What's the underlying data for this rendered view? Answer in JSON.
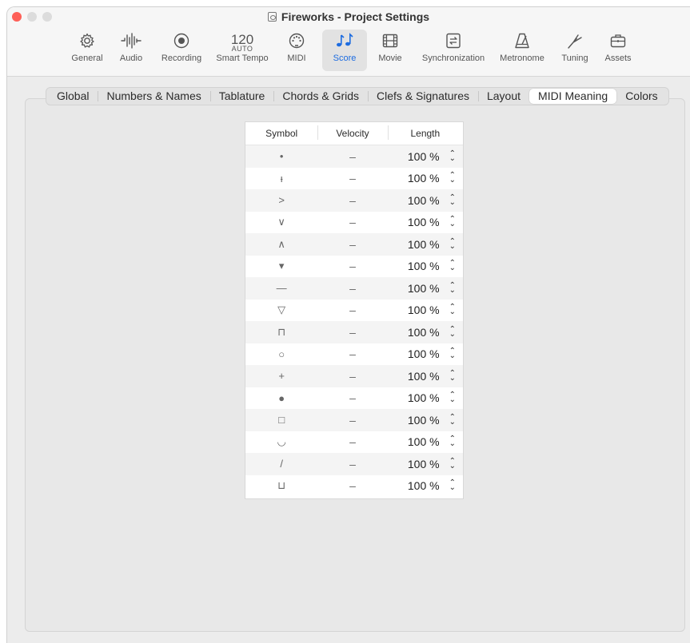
{
  "window": {
    "title": "Fireworks - Project Settings"
  },
  "toolbar": {
    "items": [
      {
        "label": "General",
        "icon": "gear-icon"
      },
      {
        "label": "Audio",
        "icon": "waveform-icon"
      },
      {
        "label": "Recording",
        "icon": "record-icon"
      },
      {
        "label": "Smart Tempo",
        "icon": "tempo-icon",
        "tempo": "120",
        "mode": "AUTO"
      },
      {
        "label": "MIDI",
        "icon": "midi-icon"
      },
      {
        "label": "Score",
        "icon": "notes-icon",
        "active": true
      },
      {
        "label": "Movie",
        "icon": "film-icon"
      },
      {
        "label": "Synchronization",
        "icon": "sync-icon"
      },
      {
        "label": "Metronome",
        "icon": "metronome-icon"
      },
      {
        "label": "Tuning",
        "icon": "tuning-fork-icon"
      },
      {
        "label": "Assets",
        "icon": "briefcase-icon"
      }
    ],
    "active_color": "#1d6ce0"
  },
  "tabs": {
    "items": [
      "Global",
      "Numbers & Names",
      "Tablature",
      "Chords & Grids",
      "Clefs & Signatures",
      "Layout",
      "MIDI Meaning",
      "Colors"
    ],
    "selected": "MIDI Meaning"
  },
  "table": {
    "headers": {
      "symbol": "Symbol",
      "velocity": "Velocity",
      "length": "Length"
    },
    "rows": [
      {
        "symbol": "•",
        "velocity": "–",
        "length": "100 %"
      },
      {
        "symbol": "ᵻ",
        "velocity": "–",
        "length": "100 %"
      },
      {
        "symbol": ">",
        "velocity": "–",
        "length": "100 %"
      },
      {
        "symbol": "∨",
        "velocity": "–",
        "length": "100 %"
      },
      {
        "symbol": "∧",
        "velocity": "–",
        "length": "100 %"
      },
      {
        "symbol": "▾",
        "velocity": "–",
        "length": "100 %"
      },
      {
        "symbol": "—",
        "velocity": "–",
        "length": "100 %"
      },
      {
        "symbol": "▽",
        "velocity": "–",
        "length": "100 %"
      },
      {
        "symbol": "⊓",
        "velocity": "–",
        "length": "100 %"
      },
      {
        "symbol": "○",
        "velocity": "–",
        "length": "100 %"
      },
      {
        "symbol": "+",
        "velocity": "–",
        "length": "100 %"
      },
      {
        "symbol": "●",
        "velocity": "–",
        "length": "100 %"
      },
      {
        "symbol": "□",
        "velocity": "–",
        "length": "100 %"
      },
      {
        "symbol": "◡",
        "velocity": "–",
        "length": "100 %"
      },
      {
        "symbol": "/",
        "velocity": "–",
        "length": "100 %"
      },
      {
        "symbol": "⊔",
        "velocity": "–",
        "length": "100 %"
      }
    ]
  }
}
